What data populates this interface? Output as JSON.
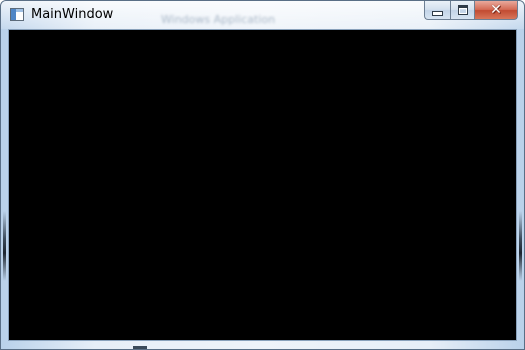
{
  "window": {
    "title": "MainWindow",
    "background_title": "Windows Application"
  },
  "caption_buttons": {
    "minimize": "minimize-icon",
    "maximize": "maximize-icon",
    "close": "close-icon",
    "close_glyph": "✕"
  },
  "colors": {
    "client_background": "#000000",
    "close_button": "#c8533b",
    "frame": "#b9d1ea"
  }
}
